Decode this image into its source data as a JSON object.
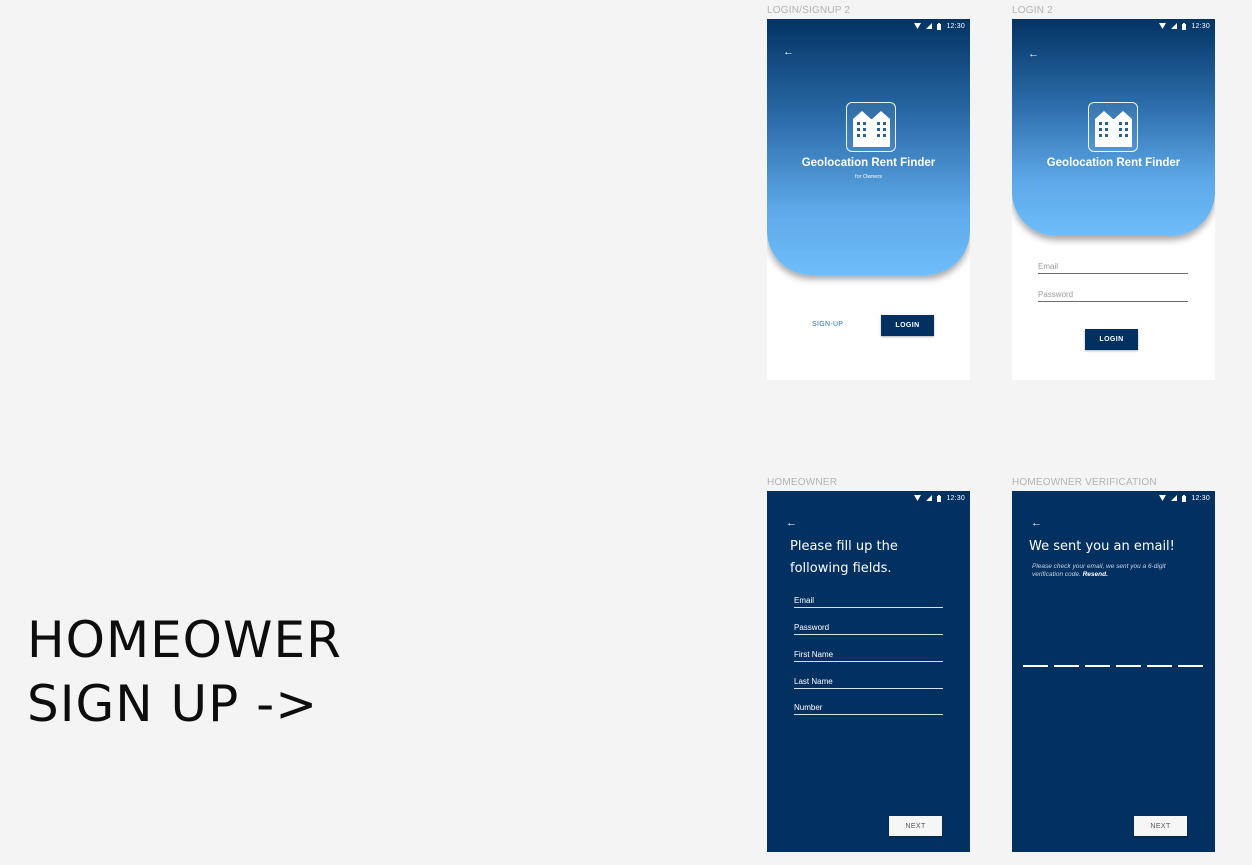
{
  "caption": {
    "line1": "HOMEOWER",
    "line2": "SIGN UP ->"
  },
  "status_time": "12:30",
  "back_glyph": "←",
  "screens": {
    "login_signup": {
      "label": "LOGIN/SIGNUP 2",
      "app_title": "Geolocation Rent Finder",
      "app_subtitle": "for Owners",
      "signup_label": "SIGN-UP",
      "login_label": "LOGIN"
    },
    "login": {
      "label": "LOGIN 2",
      "app_title": "Geolocation Rent Finder",
      "email_placeholder": "Email",
      "password_placeholder": "Password",
      "login_label": "LOGIN"
    },
    "homeowner": {
      "label": "HOMEOWNER",
      "heading_line1": "Please fill up the",
      "heading_line2": "following fields.",
      "fields": [
        "Email",
        "Password",
        "First Name",
        "Last Name",
        "Number"
      ],
      "next_label": "NEXT"
    },
    "verification": {
      "label": "HOMEOWNER VERIFICATION",
      "heading": "We sent you an email!",
      "message": "Please check your email, we sent you a 6-digit verification code.",
      "resend_label": "Resend.",
      "code_slots": 6,
      "next_label": "NEXT"
    }
  },
  "colors": {
    "navy": "#023061",
    "accent_link": "#2f6ea8",
    "gradient_top": "#023363",
    "gradient_bottom": "#6fbdfa",
    "canvas": "#f4f4f4"
  },
  "icons": [
    "back-arrow-icon",
    "wifi-icon",
    "signal-icon",
    "battery-icon",
    "building-logo-icon"
  ]
}
